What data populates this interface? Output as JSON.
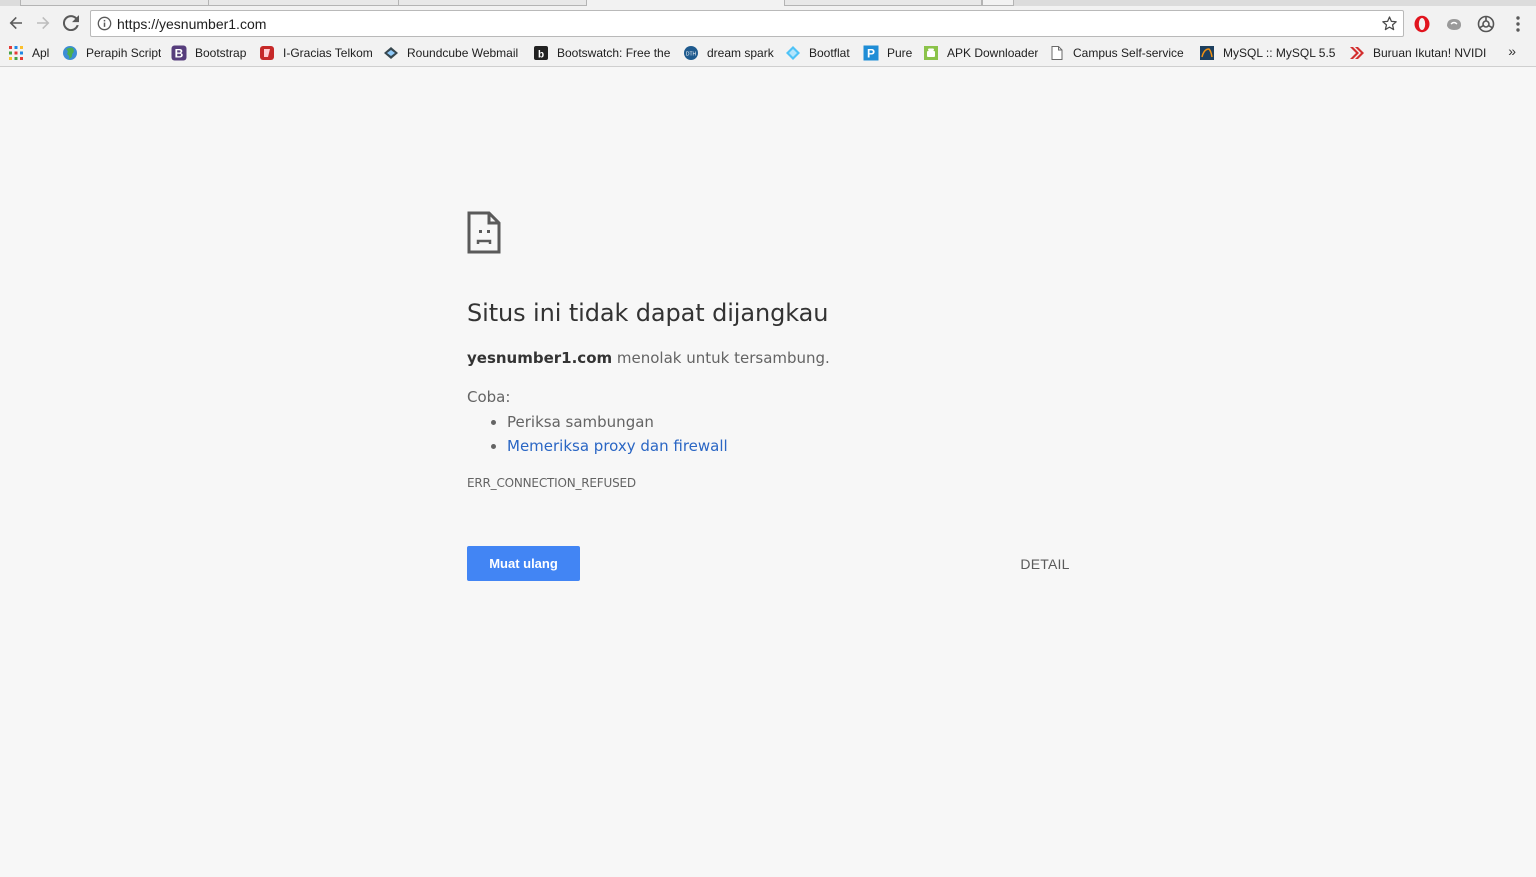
{
  "toolbar": {
    "back_icon": "back-arrow-icon",
    "forward_icon": "forward-arrow-icon",
    "reload_icon": "reload-icon",
    "url": "https://yesnumber1.com",
    "site_info_icon": "info-icon",
    "bookmark_star_icon": "star-icon",
    "extensions": [
      "opera-icon",
      "extension-icon",
      "chrome-extension-icon"
    ],
    "menu_icon": "more-vertical-icon"
  },
  "bookmarks": {
    "items": [
      {
        "label": "Apl",
        "icon": "apps-grid-icon"
      },
      {
        "label": "Perapih Script",
        "icon": "globe-icon"
      },
      {
        "label": "Bootstrap",
        "icon": "bootstrap-b-icon"
      },
      {
        "label": "I-Gracias Telkom",
        "icon": "igracias-icon"
      },
      {
        "label": "Roundcube Webmail",
        "icon": "roundcube-icon"
      },
      {
        "label": "Bootswatch: Free the",
        "icon": "bootswatch-icon"
      },
      {
        "label": "dream spark",
        "icon": "dreamspark-icon"
      },
      {
        "label": "Bootflat",
        "icon": "bootflat-icon"
      },
      {
        "label": "Pure",
        "icon": "pure-p-icon"
      },
      {
        "label": "APK Downloader",
        "icon": "android-icon"
      },
      {
        "label": "Campus Self-service",
        "icon": "page-icon"
      },
      {
        "label": "MySQL :: MySQL 5.5",
        "icon": "mysql-icon"
      },
      {
        "label": "Buruan Ikutan! NVIDI",
        "icon": "nvidia-chevron-icon"
      }
    ],
    "more_label": "»"
  },
  "error": {
    "icon": "sad-page-icon",
    "title": "Situs ini tidak dapat dijangkau",
    "host": "yesnumber1.com",
    "description": " menolak untuk tersambung.",
    "try_label": "Coba:",
    "suggestions": [
      {
        "text": "Periksa sambungan",
        "is_link": false
      },
      {
        "text": "Memeriksa proxy dan firewall",
        "is_link": true
      }
    ],
    "code": "ERR_CONNECTION_REFUSED",
    "reload_label": "Muat ulang",
    "detail_label": "DETAIL"
  },
  "colors": {
    "accent": "#4285f4",
    "link": "#2a66c4",
    "background": "#f7f7f7"
  }
}
